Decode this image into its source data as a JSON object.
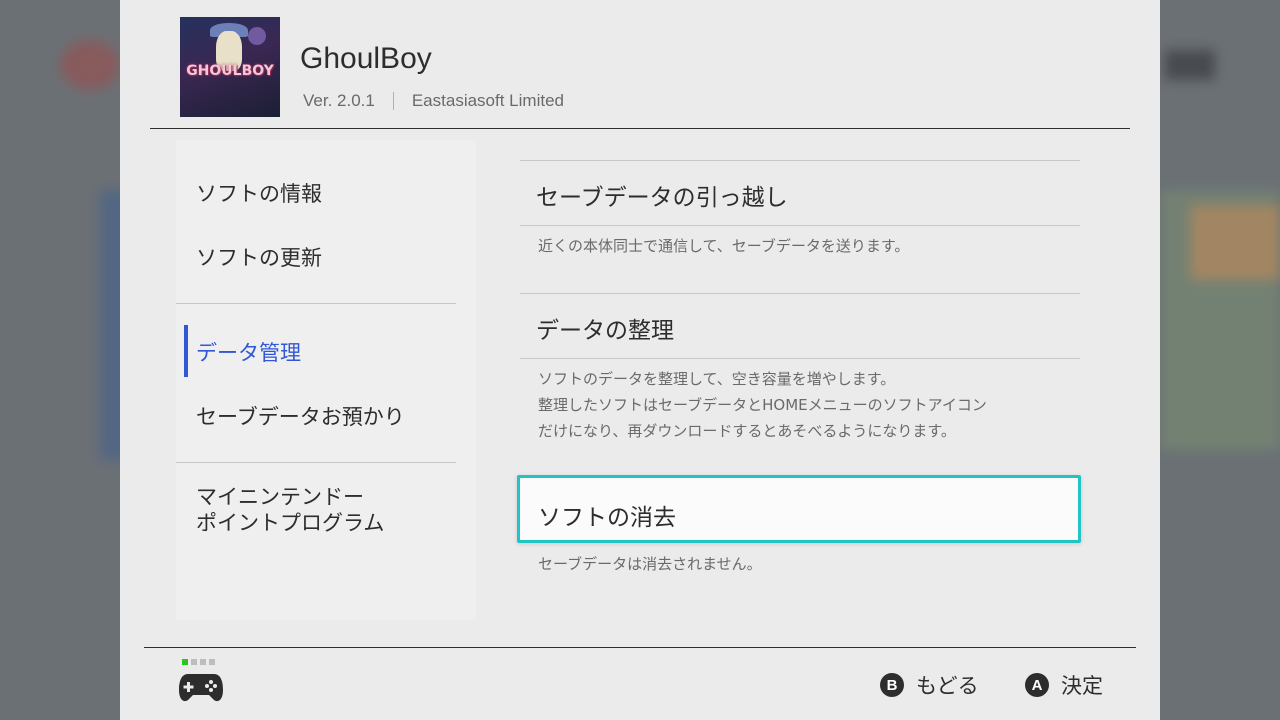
{
  "game": {
    "title": "GhoulBoy",
    "version": "Ver. 2.0.1",
    "publisher": "Eastasiasoft Limited",
    "art_logo": "GHOULBOY"
  },
  "sidebar": {
    "items": [
      {
        "label": "ソフトの情報"
      },
      {
        "label": "ソフトの更新"
      },
      {
        "label": "データ管理",
        "active": true
      },
      {
        "label": "セーブデータお預かり"
      },
      {
        "label_line1": "マイニンテンドー",
        "label_line2": "ポイントプログラム"
      }
    ]
  },
  "content": {
    "options": [
      {
        "title": "セーブデータの引っ越し",
        "desc": [
          "近くの本体同士で通信して、セーブデータを送ります。"
        ]
      },
      {
        "title": "データの整理",
        "desc": [
          "ソフトのデータを整理して、空き容量を増やします。",
          "整理したソフトはセーブデータとHOMEメニューのソフトアイコン",
          "だけになり、再ダウンロードするとあそべるようになります。"
        ]
      },
      {
        "title": "ソフトの消去",
        "desc": [
          "セーブデータは消去されません。"
        ],
        "focused": true
      }
    ]
  },
  "footer": {
    "back": {
      "key": "B",
      "label": "もどる"
    },
    "confirm": {
      "key": "A",
      "label": "決定"
    },
    "controller_icon": "gamepad-icon"
  },
  "colors": {
    "accent_blue": "#3156d6",
    "focus_cyan": "#20c4c4",
    "user_dot": "#2ec51a"
  }
}
